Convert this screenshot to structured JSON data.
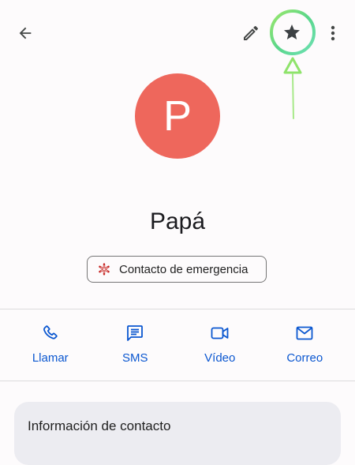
{
  "toolbar": {
    "back_icon": "arrow-back-icon",
    "edit_icon": "pencil-icon",
    "favorite_icon": "star-icon",
    "more_icon": "more-vert-icon"
  },
  "contact": {
    "initial": "P",
    "name": "Papá",
    "avatar_color": "#ee675c",
    "emergency_label": "Contacto de emergencia",
    "emergency_icon": "medical-asterisk-icon",
    "emergency_icon_color": "#c5221f"
  },
  "actions": [
    {
      "label": "Llamar",
      "icon": "phone-icon"
    },
    {
      "label": "SMS",
      "icon": "message-icon"
    },
    {
      "label": "Vídeo",
      "icon": "video-icon"
    },
    {
      "label": "Correo",
      "icon": "mail-icon"
    }
  ],
  "info_section": {
    "title": "Información de contacto"
  },
  "colors": {
    "accent": "#0b57d0",
    "highlight": "#7fe25a"
  }
}
